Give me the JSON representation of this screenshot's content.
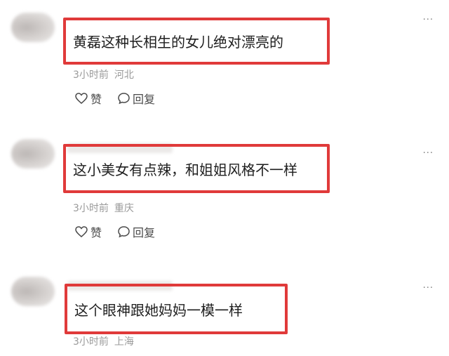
{
  "more_icon_glyph": "···",
  "comments": [
    {
      "text": "黄磊这种长相生的女儿绝对漂亮的",
      "time": "3小时前",
      "location": "河北",
      "like_label": "赞",
      "reply_label": "回复"
    },
    {
      "text": "这小美女有点辣，和姐姐风格不一样",
      "time": "3小时前",
      "location": "重庆",
      "like_label": "赞",
      "reply_label": "回复"
    },
    {
      "text": "这个眼神跟她妈妈一模一样",
      "time": "3小时前",
      "location": "上海"
    }
  ],
  "colors": {
    "highlight": "#e03a3a",
    "meta": "#9a9a9a",
    "text": "#1e1e1e"
  },
  "icons": {
    "like": "heart-outline-icon",
    "reply": "speech-bubble-icon",
    "more": "more-dots-icon"
  }
}
